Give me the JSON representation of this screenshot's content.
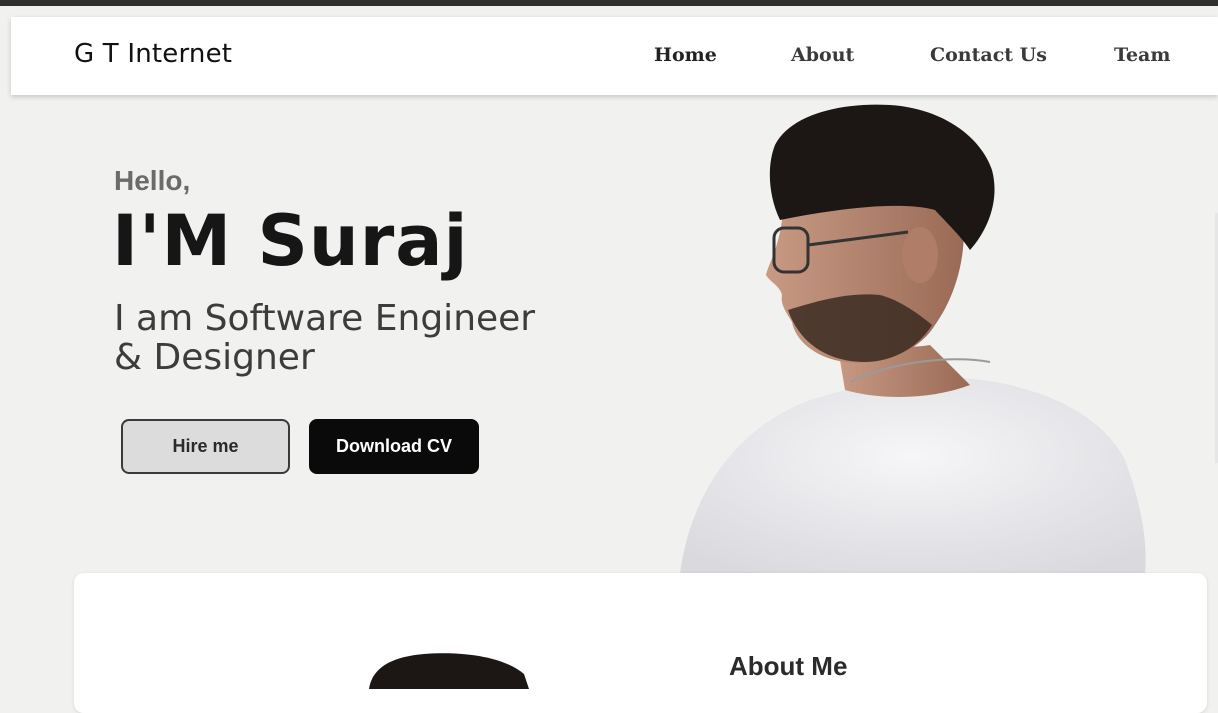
{
  "brand": {
    "name": "G T Internet"
  },
  "nav": {
    "items": [
      {
        "label": "Home",
        "active": true
      },
      {
        "label": "About",
        "active": false
      },
      {
        "label": "Contact Us",
        "active": false
      },
      {
        "label": "Team",
        "active": false
      }
    ]
  },
  "hero": {
    "greeting": "Hello,",
    "name": "I'M Suraj",
    "role_line1": "I am Software Engineer",
    "role_line2": "& Designer",
    "hire_button": "Hire me",
    "cv_button": "Download CV"
  },
  "about": {
    "title": "About Me"
  },
  "colors": {
    "page_background": "#f1f2f0",
    "top_bar": "#2f2f2f",
    "primary_button": "#0a0a0a",
    "secondary_button": "#dcdcdc"
  },
  "icons": [
    "portrait-photo",
    "about-photo"
  ]
}
